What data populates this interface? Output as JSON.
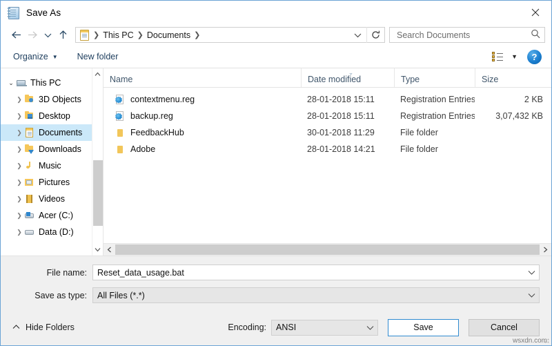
{
  "window": {
    "title": "Save As",
    "title_icon": "notepad-icon",
    "close_label": "✕"
  },
  "address_bar": {
    "back_icon": "back-arrow-icon",
    "forward_icon": "forward-arrow-icon",
    "recent_icon": "chevron-down-icon",
    "up_icon": "up-arrow-icon",
    "path_icon": "documents-folder-icon",
    "breadcrumbs": [
      "This PC",
      "Documents"
    ],
    "separator": "❯",
    "dropdown_icon": "chevron-down-icon",
    "refresh_icon": "refresh-icon",
    "search_placeholder": "Search Documents",
    "search_value": "",
    "search_icon": "search-icon"
  },
  "toolbar": {
    "organize_label": "Organize",
    "organize_caret": "▼",
    "new_folder_label": "New folder",
    "view_icon": "view-options-icon",
    "view_caret": "▼",
    "help_label": "?",
    "help_icon": "help-icon"
  },
  "sidebar": {
    "items": [
      {
        "label": "This PC",
        "icon": "this-pc-icon",
        "level": 0,
        "expander": "⌄",
        "expanded": true,
        "selected": false
      },
      {
        "label": "3D Objects",
        "icon": "3d-objects-icon",
        "level": 1,
        "expander": "❯",
        "expanded": false,
        "selected": false
      },
      {
        "label": "Desktop",
        "icon": "desktop-icon",
        "level": 1,
        "expander": "❯",
        "expanded": false,
        "selected": false
      },
      {
        "label": "Documents",
        "icon": "documents-icon",
        "level": 1,
        "expander": "❯",
        "expanded": false,
        "selected": true
      },
      {
        "label": "Downloads",
        "icon": "downloads-icon",
        "level": 1,
        "expander": "❯",
        "expanded": false,
        "selected": false
      },
      {
        "label": "Music",
        "icon": "music-icon",
        "level": 1,
        "expander": "❯",
        "expanded": false,
        "selected": false
      },
      {
        "label": "Pictures",
        "icon": "pictures-icon",
        "level": 1,
        "expander": "❯",
        "expanded": false,
        "selected": false
      },
      {
        "label": "Videos",
        "icon": "videos-icon",
        "level": 1,
        "expander": "❯",
        "expanded": false,
        "selected": false
      },
      {
        "label": "Acer (C:)",
        "icon": "windows-drive-icon",
        "level": 1,
        "expander": "❯",
        "expanded": false,
        "selected": false
      },
      {
        "label": "Data (D:)",
        "icon": "drive-icon",
        "level": 1,
        "expander": "❯",
        "expanded": false,
        "selected": false
      }
    ],
    "scroll_up_icon": "scroll-up-arrow-icon",
    "scroll_down_icon": "scroll-down-arrow-icon"
  },
  "file_list": {
    "columns": [
      {
        "label": "Name",
        "sorted": false
      },
      {
        "label": "Date modified",
        "sorted": true,
        "sort_indicator": "⌄"
      },
      {
        "label": "Type",
        "sorted": false
      },
      {
        "label": "Size",
        "sorted": false
      }
    ],
    "rows": [
      {
        "name": "contextmenu.reg",
        "icon": "registry-file-icon",
        "date": "28-01-2018 15:11",
        "type": "Registration Entries",
        "size": "2 KB"
      },
      {
        "name": "backup.reg",
        "icon": "registry-file-icon",
        "date": "28-01-2018 15:11",
        "type": "Registration Entries",
        "size": "3,07,432 KB"
      },
      {
        "name": "FeedbackHub",
        "icon": "folder-icon",
        "date": "30-01-2018 11:29",
        "type": "File folder",
        "size": ""
      },
      {
        "name": "Adobe",
        "icon": "folder-icon",
        "date": "28-01-2018 14:21",
        "type": "File folder",
        "size": ""
      }
    ],
    "scroll_left_icon": "scroll-left-arrow-icon",
    "scroll_right_icon": "scroll-right-arrow-icon"
  },
  "form": {
    "file_name_label": "File name:",
    "file_name_value": "Reset_data_usage.bat",
    "file_name_caret": "⌄",
    "save_as_type_label": "Save as type:",
    "save_as_type_value": "All Files  (*.*)",
    "save_as_type_caret": "⌄"
  },
  "footer": {
    "hide_folders_label": "Hide Folders",
    "hide_folders_caret": "⌃",
    "encoding_label": "Encoding:",
    "encoding_value": "ANSI",
    "encoding_caret": "⌄",
    "save_label": "Save",
    "cancel_label": "Cancel",
    "watermark": "wsxdn.com"
  },
  "colors": {
    "accent": "#2f8ad0",
    "selection": "#cbe8f9",
    "window_border": "#6aa3d5",
    "chrome": "#f0f0f0"
  }
}
